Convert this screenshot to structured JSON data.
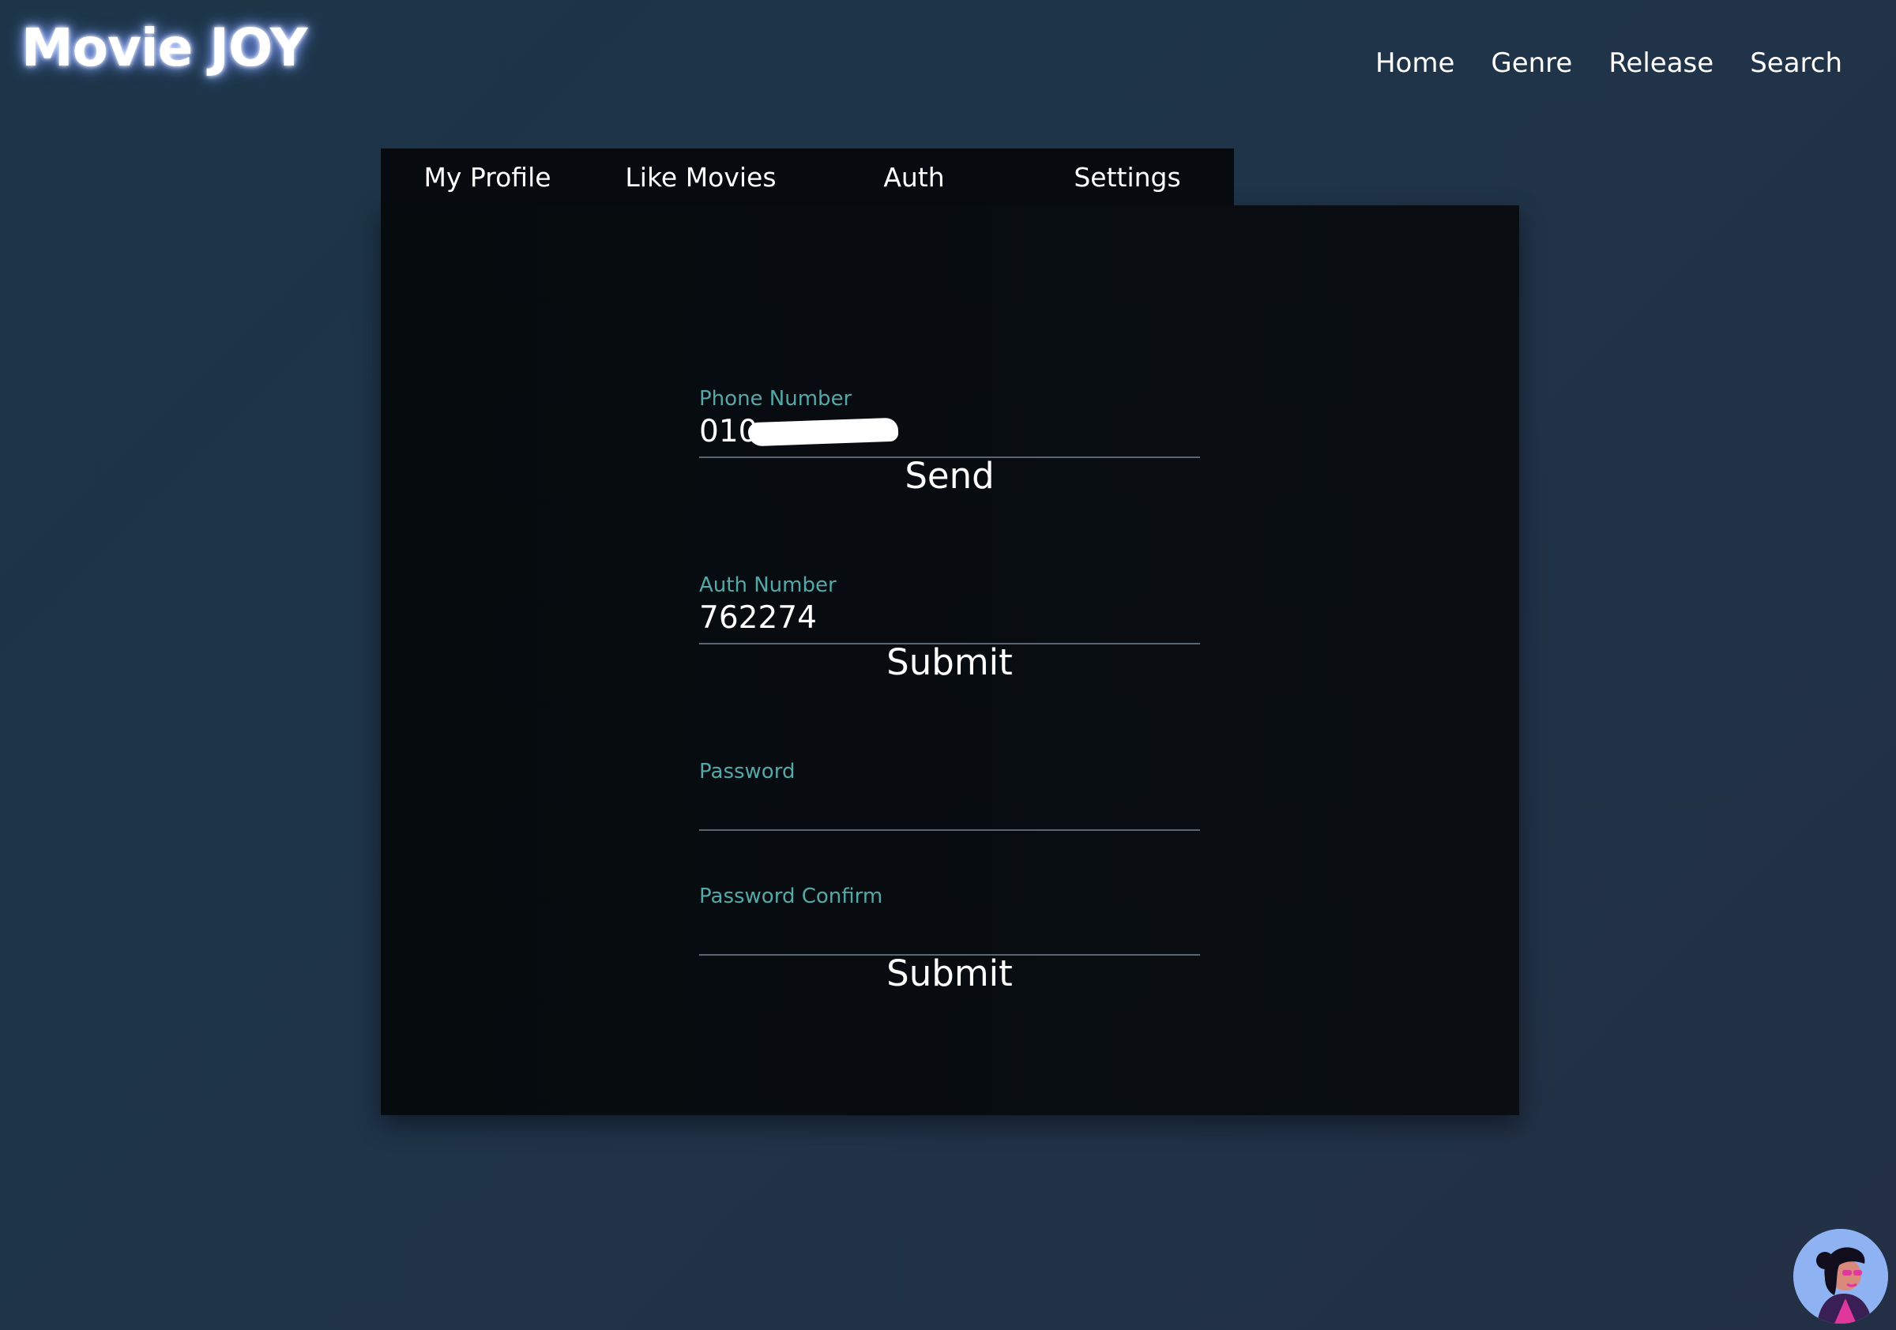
{
  "app": {
    "logo": "Movie JOY"
  },
  "top_nav": {
    "items": [
      "Home",
      "Genre",
      "Release",
      "Search"
    ]
  },
  "tabs": {
    "items": [
      "My Profile",
      "Like Movies",
      "Auth",
      "Settings"
    ]
  },
  "form": {
    "phone": {
      "label": "Phone Number",
      "value": "010"
    },
    "send_label": "Send",
    "auth": {
      "label": "Auth Number",
      "value": "762274"
    },
    "auth_submit_label": "Submit",
    "password": {
      "label": "Password",
      "value": ""
    },
    "password_confirm": {
      "label": "Password Confirm",
      "value": ""
    },
    "password_submit_label": "Submit"
  },
  "colors": {
    "accent_label": "#54a9a8",
    "avatar_bg": "#8fb3f2",
    "avatar_accent": "#e0379a"
  },
  "icons": {
    "avatar": "user-avatar-icon"
  }
}
